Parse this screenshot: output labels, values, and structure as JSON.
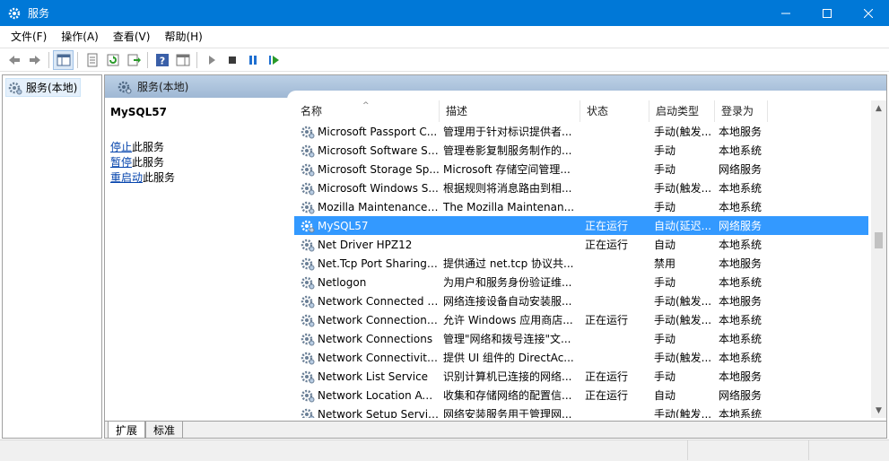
{
  "window": {
    "title": "服务"
  },
  "menu": [
    "文件(F)",
    "操作(A)",
    "查看(V)",
    "帮助(H)"
  ],
  "tree": {
    "root_label": "服务(本地)"
  },
  "pane_header": "服务(本地)",
  "details": {
    "service_name": "MySQL57",
    "actions": [
      {
        "link": "停止",
        "rest": "此服务"
      },
      {
        "link": "暂停",
        "rest": "此服务"
      },
      {
        "link": "重启动",
        "rest": "此服务"
      }
    ]
  },
  "columns": [
    "名称",
    "描述",
    "状态",
    "启动类型",
    "登录为"
  ],
  "rows": [
    {
      "name": "Microsoft Passport C...",
      "desc": "管理用于针对标识提供者...",
      "status": "",
      "start": "手动(触发...",
      "login": "本地服务"
    },
    {
      "name": "Microsoft Software Sh...",
      "desc": "管理卷影复制服务制作的...",
      "status": "",
      "start": "手动",
      "login": "本地系统"
    },
    {
      "name": "Microsoft Storage Sp...",
      "desc": "Microsoft 存储空间管理...",
      "status": "",
      "start": "手动",
      "login": "网络服务"
    },
    {
      "name": "Microsoft Windows S...",
      "desc": "根据规则将消息路由到相...",
      "status": "",
      "start": "手动(触发...",
      "login": "本地系统"
    },
    {
      "name": "Mozilla Maintenance ...",
      "desc": "The Mozilla Maintenan...",
      "status": "",
      "start": "手动",
      "login": "本地系统"
    },
    {
      "name": "MySQL57",
      "desc": "",
      "status": "正在运行",
      "start": "自动(延迟...",
      "login": "网络服务",
      "selected": true
    },
    {
      "name": "Net Driver HPZ12",
      "desc": "",
      "status": "正在运行",
      "start": "自动",
      "login": "本地系统"
    },
    {
      "name": "Net.Tcp Port Sharing ...",
      "desc": "提供通过 net.tcp 协议共...",
      "status": "",
      "start": "禁用",
      "login": "本地服务"
    },
    {
      "name": "Netlogon",
      "desc": "为用户和服务身份验证维...",
      "status": "",
      "start": "手动",
      "login": "本地系统"
    },
    {
      "name": "Network Connected D...",
      "desc": "网络连接设备自动安装服...",
      "status": "",
      "start": "手动(触发...",
      "login": "本地服务"
    },
    {
      "name": "Network Connection ...",
      "desc": "允许 Windows 应用商店...",
      "status": "正在运行",
      "start": "手动(触发...",
      "login": "本地系统"
    },
    {
      "name": "Network Connections",
      "desc": "管理\"网络和拨号连接\"文...",
      "status": "",
      "start": "手动",
      "login": "本地系统"
    },
    {
      "name": "Network Connectivity ...",
      "desc": "提供 UI 组件的 DirectAc...",
      "status": "",
      "start": "手动(触发...",
      "login": "本地系统"
    },
    {
      "name": "Network List Service",
      "desc": "识别计算机已连接的网络...",
      "status": "正在运行",
      "start": "手动",
      "login": "本地服务"
    },
    {
      "name": "Network Location Aw...",
      "desc": "收集和存储网络的配置信...",
      "status": "正在运行",
      "start": "自动",
      "login": "网络服务"
    },
    {
      "name": "Network Setup Service",
      "desc": "网络安装服务用于管理网...",
      "status": "",
      "start": "手动(触发...",
      "login": "本地系统"
    }
  ],
  "tabs": [
    "扩展",
    "标准"
  ],
  "colors": {
    "titlebar": "#0078d7",
    "selection": "#3399ff",
    "link": "#0645ad"
  }
}
